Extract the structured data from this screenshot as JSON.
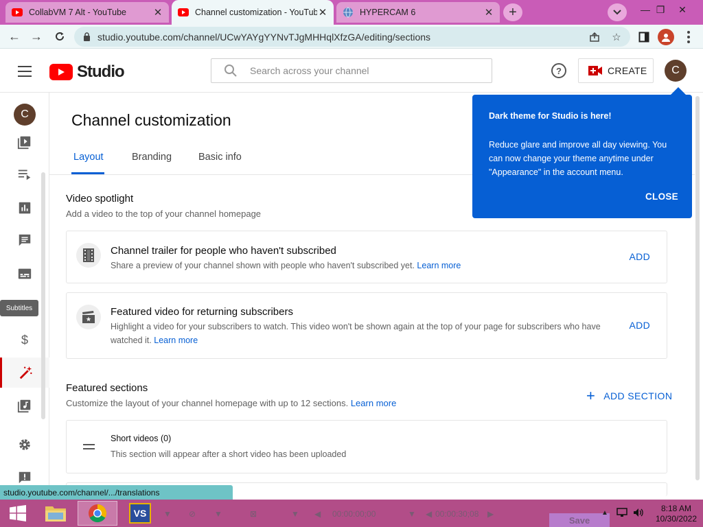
{
  "browser": {
    "tabs": [
      {
        "title": "CollabVM 7 Alt - YouTube",
        "active": false
      },
      {
        "title": "Channel customization - YouTube",
        "active": true
      },
      {
        "title": "HYPERCAM 6",
        "active": false
      }
    ],
    "url": "studio.youtube.com/channel/UCwYAYgYYNvTJgMHHqlXfzGA/editing/sections",
    "status_url": "studio.youtube.com/channel/.../translations"
  },
  "header": {
    "logo_text": "Studio",
    "search_placeholder": "Search across your channel",
    "create_label": "CREATE",
    "avatar_letter": "C"
  },
  "rail": {
    "avatar_letter": "C",
    "tooltip": "Subtitles"
  },
  "page": {
    "title": "Channel customization",
    "tabs": [
      "Layout",
      "Branding",
      "Basic info"
    ]
  },
  "spotlight": {
    "title": "Video spotlight",
    "subtitle": "Add a video to the top of your channel homepage",
    "cards": [
      {
        "title": "Channel trailer for people who haven't subscribed",
        "desc": "Share a preview of your channel shown with people who haven't subscribed yet.",
        "link": "Learn more",
        "action": "ADD"
      },
      {
        "title": "Featured video for returning subscribers",
        "desc": "Highlight a video for your subscribers to watch. This video won't be shown again at the top of your page for subscribers who have watched it.",
        "link": "Learn more",
        "action": "ADD"
      }
    ]
  },
  "featured": {
    "title": "Featured sections",
    "subtitle": "Customize the layout of your channel homepage with up to 12 sections.",
    "link": "Learn more",
    "add_label": "ADD SECTION",
    "sections": [
      {
        "title": "Short videos (0)",
        "desc": "This section will appear after a short video has been uploaded"
      }
    ]
  },
  "popup": {
    "title": "Dark theme for Studio is here!",
    "body": "Reduce glare and improve all day viewing. You can now change your theme anytime under \"Appearance\" in the account menu.",
    "close_label": "CLOSE"
  },
  "taskbar": {
    "time_start": "00:00:00;00",
    "time_end": "00:00:30;08",
    "save_label": "Save",
    "clock_time": "8:18 AM",
    "clock_date": "10/30/2022",
    "app_vs_label": "VS"
  },
  "colors": {
    "accent": "#065fd4",
    "brand_red": "#ff0000",
    "tab_strip": "#c95cb7",
    "taskbar": "#b24d88"
  }
}
